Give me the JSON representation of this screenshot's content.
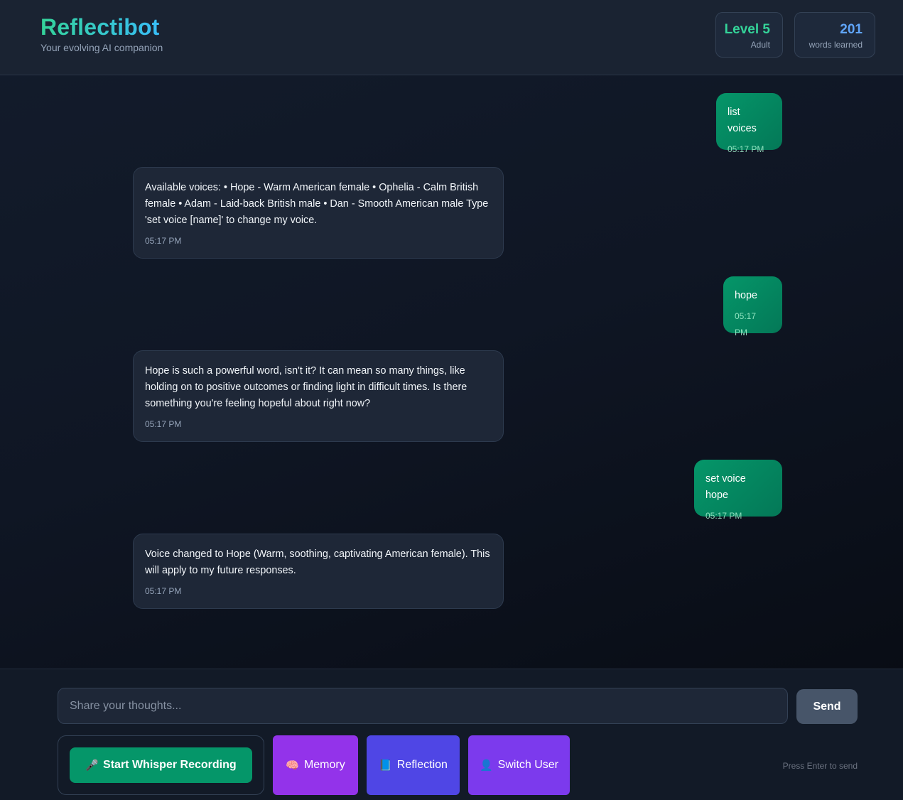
{
  "header": {
    "title": "Reflectibot",
    "subtitle": "Your evolving AI companion",
    "level": {
      "value": "Level 5",
      "label": "Adult"
    },
    "words": {
      "value": "201",
      "label": "words learned"
    }
  },
  "messages": [
    {
      "role": "user",
      "text": "list voices",
      "time": "05:17 PM"
    },
    {
      "role": "bot",
      "text": "Available voices: • Hope - Warm American female • Ophelia - Calm British female • Adam - Laid-back British male • Dan - Smooth American male Type 'set voice [name]' to change my voice.",
      "time": "05:17 PM"
    },
    {
      "role": "user",
      "text": "hope",
      "time": "05:17 PM"
    },
    {
      "role": "bot",
      "text": "Hope is such a powerful word, isn't it? It can mean so many things, like holding on to positive outcomes or finding light in difficult times. Is there something you're feeling hopeful about right now?",
      "time": "05:17 PM"
    },
    {
      "role": "user",
      "text": "set voice hope",
      "time": "05:17 PM"
    },
    {
      "role": "bot",
      "text": "Voice changed to Hope (Warm, soothing, captivating American female). This will apply to my future responses.",
      "time": "05:17 PM"
    }
  ],
  "input": {
    "placeholder": "Share your thoughts...",
    "value": "",
    "send_label": "Send",
    "hint": "Press Enter to send"
  },
  "actions": {
    "record": {
      "icon": "microphone-icon",
      "glyph": "🎤",
      "label": "Start Whisper Recording"
    },
    "memory": {
      "icon": "brain-icon",
      "glyph": "🧠",
      "label": "Memory"
    },
    "reflection": {
      "icon": "book-icon",
      "glyph": "📘",
      "label": "Reflection"
    },
    "switch_user": {
      "icon": "user-icon",
      "glyph": "👤",
      "label": "Switch User"
    }
  }
}
